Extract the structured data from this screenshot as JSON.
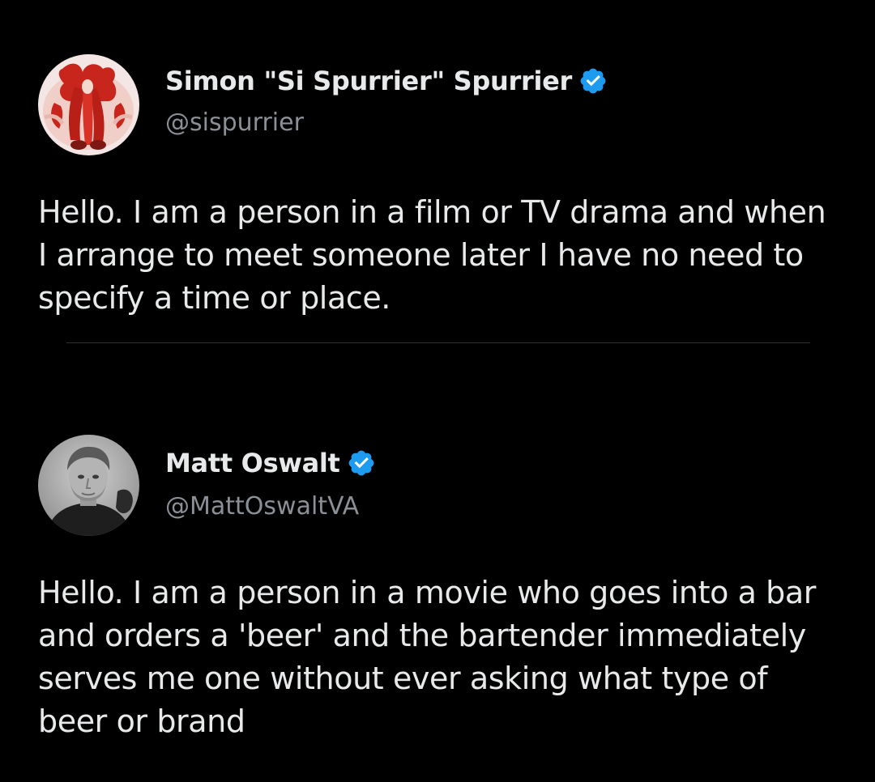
{
  "tweets": [
    {
      "author": {
        "display_name": "Simon \"Si Spurrier\" Spurrier",
        "handle": "@sispurrier",
        "verified": true
      },
      "text": "Hello. I am a person in a film or TV drama and when I arrange to meet someone later I have no need to specify a time or place."
    },
    {
      "author": {
        "display_name": "Matt Oswalt",
        "handle": "@MattOswaltVA",
        "verified": true
      },
      "text": "Hello. I am a person in a movie who goes into a bar and orders a 'beer' and the bartender immediately serves me one without ever asking what type of beer or brand"
    }
  ],
  "icons": {
    "verified": "verified-badge-icon",
    "avatar_1": "avatar-red-costume",
    "avatar_2": "avatar-bw-portrait"
  },
  "colors": {
    "background": "#000000",
    "primary_text": "#e7e9ea",
    "secondary_text": "#8b9096",
    "verified_blue": "#1d9bf0",
    "divider": "#2f3336"
  }
}
